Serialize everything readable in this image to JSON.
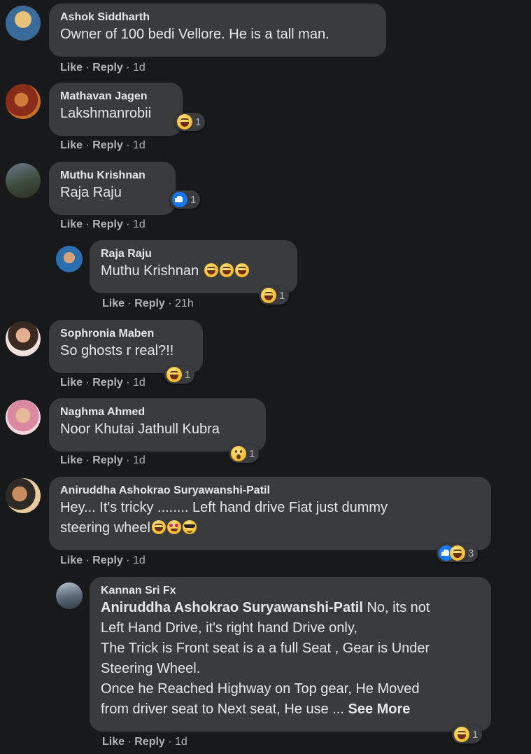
{
  "comments": [
    {
      "author": "Ashok Siddharth",
      "text": "Owner of 100 bedi Vellore. He is a tall man.",
      "actions": {
        "like": "Like",
        "reply": "Reply",
        "time": "1d"
      }
    },
    {
      "author": "Mathavan Jagen",
      "text": "Lakshmanrobii",
      "actions": {
        "like": "Like",
        "reply": "Reply",
        "time": "1d"
      },
      "reactions": {
        "icons": [
          "haha"
        ],
        "count": "1"
      }
    },
    {
      "author": "Muthu Krishnan",
      "text": "Raja Raju",
      "actions": {
        "like": "Like",
        "reply": "Reply",
        "time": "1d"
      },
      "reactions": {
        "icons": [
          "like"
        ],
        "count": "1"
      }
    },
    {
      "author": "Raja Raju",
      "text": "Muthu Krishnan",
      "emojis": [
        "haha",
        "haha",
        "haha"
      ],
      "actions": {
        "like": "Like",
        "reply": "Reply",
        "time": "21h"
      },
      "reactions": {
        "icons": [
          "haha"
        ],
        "count": "1"
      }
    },
    {
      "author": "Sophronia Maben",
      "text": "So ghosts r real?!!",
      "actions": {
        "like": "Like",
        "reply": "Reply",
        "time": "1d"
      },
      "reactions": {
        "icons": [
          "haha"
        ],
        "count": "1"
      }
    },
    {
      "author": "Naghma Ahmed",
      "text": "Noor Khutai Jathull Kubra",
      "actions": {
        "like": "Like",
        "reply": "Reply",
        "time": "1d"
      },
      "reactions": {
        "icons": [
          "wow"
        ],
        "count": "1"
      }
    },
    {
      "author": "Aniruddha Ashokrao Suryawanshi-Patil",
      "text_line1": "Hey... It's tricky ........ Left hand drive Fiat just dummy",
      "text_line2": "steering wheel",
      "emojis": [
        "haha",
        "heart-eyes",
        "sunglasses"
      ],
      "actions": {
        "like": "Like",
        "reply": "Reply",
        "time": "1d"
      },
      "reactions": {
        "icons": [
          "like",
          "haha"
        ],
        "count": "3"
      }
    },
    {
      "author": "Kannan Sri Fx",
      "mention": "Aniruddha Ashokrao Suryawanshi-Patil",
      "text_line1": " No, its not",
      "text_line2": "Left Hand Drive, it's right hand Drive only,",
      "text_line3": "The Trick is Front seat is a a full Seat , Gear is Under",
      "text_line4": "Steering Wheel.",
      "text_line5": "Once he Reached Highway on Top gear, He Moved",
      "text_line6": "from driver seat to Next seat, He use ...",
      "see_more": " See More",
      "actions": {
        "like": "Like",
        "reply": "Reply",
        "time": "1d"
      },
      "reactions": {
        "icons": [
          "haha"
        ],
        "count": "1"
      }
    }
  ],
  "separator": " · "
}
